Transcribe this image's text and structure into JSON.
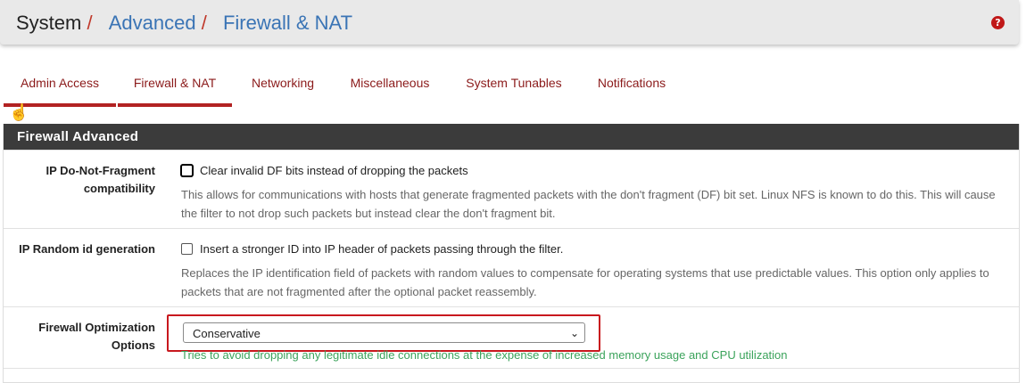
{
  "breadcrumb": {
    "system": "System",
    "sep1": "/",
    "advanced": "Advanced",
    "sep2": "/",
    "current": "Firewall & NAT"
  },
  "help_icon": "question-circle-icon",
  "tabs": [
    {
      "label": "Admin Access"
    },
    {
      "label": "Firewall & NAT"
    },
    {
      "label": "Networking"
    },
    {
      "label": "Miscellaneous"
    },
    {
      "label": "System Tunables"
    },
    {
      "label": "Notifications"
    }
  ],
  "panel": {
    "title": "Firewall Advanced",
    "rows": [
      {
        "label": "IP Do-Not-Fragment compatibility",
        "checkbox_label": "Clear invalid DF bits instead of dropping the packets",
        "help": "This allows for communications with hosts that generate fragmented packets with the don't fragment (DF) bit set. Linux NFS is known to do this. This will cause the filter to not drop such packets but instead clear the don't fragment bit."
      },
      {
        "label": "IP Random id generation",
        "checkbox_label": "Insert a stronger ID into IP header of packets passing through the filter.",
        "help": "Replaces the IP identification field of packets with random values to compensate for operating systems that use predictable values. This option only applies to packets that are not fragmented after the optional packet reassembly."
      },
      {
        "label_line1": "Firewall Optimization",
        "label_line2": "Options",
        "select_value": "Conservative",
        "help": "Tries to avoid dropping any legitimate idle connections at the expense of increased memory usage and CPU utilization"
      }
    ]
  }
}
